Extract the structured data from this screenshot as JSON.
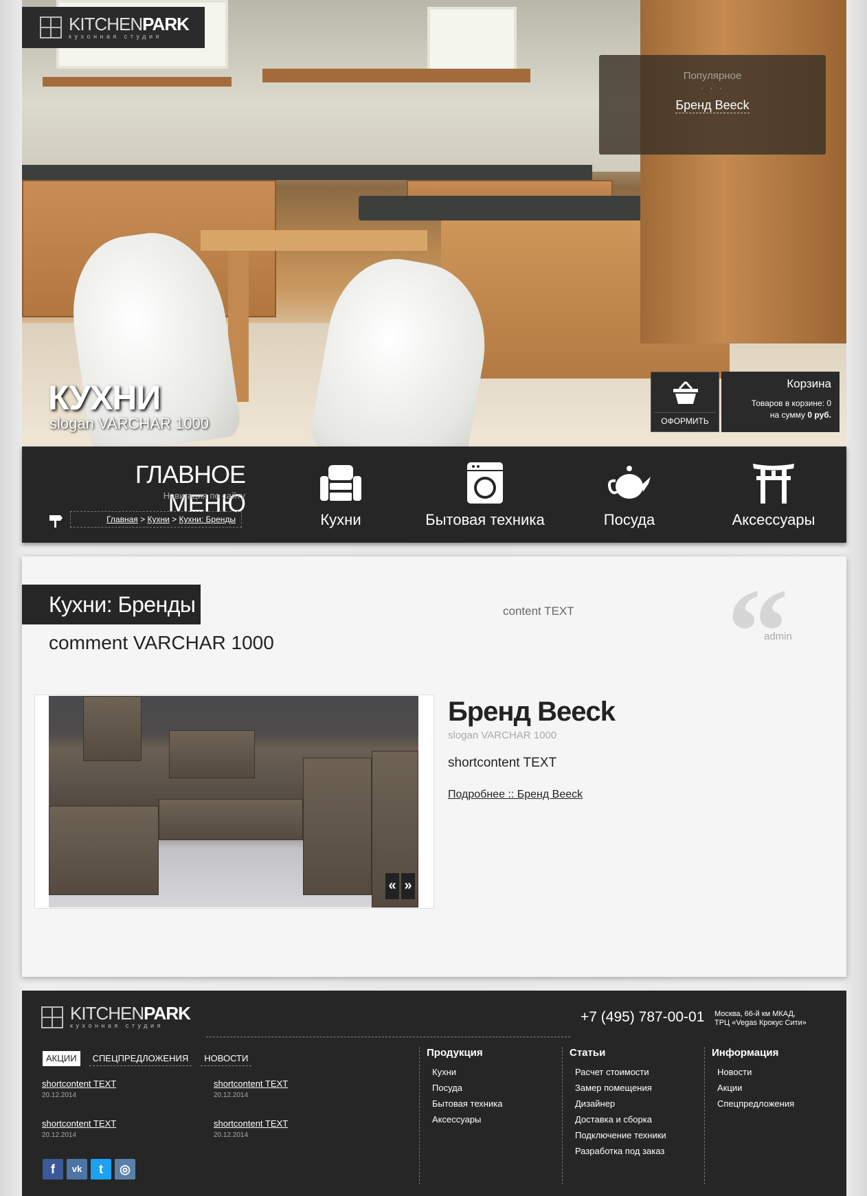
{
  "header": {
    "logo": {
      "word_light": "KITCHEN",
      "word_bold": "PARK",
      "tagline": "кухонная студия"
    },
    "popular": {
      "title": "Популярное",
      "dots": "· · ·",
      "link": "Бренд Beeck"
    },
    "hero_title": "КУХНИ",
    "hero_slogan": "slogan VARCHAR 1000",
    "cart": {
      "checkout_label": "ОФОРМИТЬ",
      "title": "Корзина",
      "items_text": "Товаров в корзине: 0",
      "sum_prefix": "на сумму",
      "sum_value": "0 руб."
    }
  },
  "nav": {
    "title": "ГЛАВНОЕ МЕНЮ",
    "subtitle": "Навигация по сайту",
    "breadcrumb": [
      {
        "label": "Главная"
      },
      {
        "label": "Кухни"
      },
      {
        "label": "Кухни: Бренды"
      }
    ],
    "breadcrumb_sep": ">",
    "items": [
      {
        "label": "Кухни",
        "icon": "armchair-icon"
      },
      {
        "label": "Бытовая техника",
        "icon": "washing-machine-icon"
      },
      {
        "label": "Посуда",
        "icon": "teapot-icon"
      },
      {
        "label": "Аксессуары",
        "icon": "torii-gate-icon"
      }
    ]
  },
  "content": {
    "title": "Кухни: Бренды",
    "comment": "comment VARCHAR 1000",
    "text": "content TEXT",
    "quote_mark": "“",
    "author": "admin",
    "brand": {
      "name": "Бренд Beeck",
      "slogan": "slogan VARCHAR 1000",
      "shortcontent": "shortcontent TEXT",
      "more_link": "Подробнее :: Бренд Beeck"
    },
    "slider": {
      "prev": "«",
      "next": "»"
    }
  },
  "footer": {
    "phone": "+7 (495) 787-00-01",
    "address_line1": "Москва, 66-й км МКАД,",
    "address_line2": "ТРЦ «Vegas Крокус Сити»",
    "tabs": [
      "АКЦИИ",
      "СПЕЦПРЕДЛОЖЕНИЯ",
      "НОВОСТИ"
    ],
    "news": [
      {
        "title": "shortcontent TEXT",
        "date": "20.12.2014"
      },
      {
        "title": "shortcontent TEXT",
        "date": "20.12.2014"
      },
      {
        "title": "shortcontent TEXT",
        "date": "20.12.2014"
      },
      {
        "title": "shortcontent TEXT",
        "date": "20.12.2014"
      }
    ],
    "social": [
      {
        "icon": "facebook-icon",
        "glyph": "f",
        "color": "#3b5998"
      },
      {
        "icon": "vk-icon",
        "glyph": "vk",
        "color": "#4c75a3"
      },
      {
        "icon": "twitter-icon",
        "glyph": "t",
        "color": "#1da1f2"
      },
      {
        "icon": "instagram-icon",
        "glyph": "◎",
        "color": "#5a80a8"
      }
    ],
    "columns": [
      {
        "title": "Продукция",
        "items": [
          "Кухни",
          "Посуда",
          "Бытовая техника",
          "Аксессуары"
        ]
      },
      {
        "title": "Статьи",
        "items": [
          "Расчет стоимости",
          "Замер помещения",
          "Дизайнер",
          "Доставка и сборка",
          "Подключение техники",
          "Разработка под заказ"
        ]
      },
      {
        "title": "Информация",
        "items": [
          "Новости",
          "Акции",
          "Спецпредложения"
        ]
      }
    ]
  },
  "colors": {
    "dark_panel": "#262626",
    "content_bg": "#f5f5f5",
    "page_bg": "#e8e8e8"
  }
}
